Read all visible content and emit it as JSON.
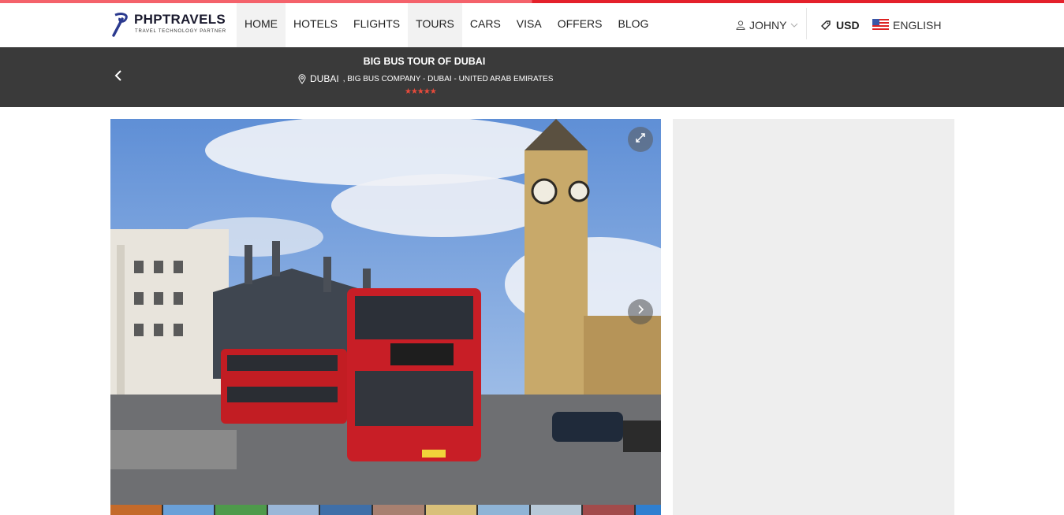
{
  "brand": {
    "name": "PHPTRAVELS",
    "tagline": "TRAVEL TECHNOLOGY PARTNER"
  },
  "nav": {
    "items": [
      {
        "label": "HOME",
        "active": true
      },
      {
        "label": "HOTELS",
        "active": false
      },
      {
        "label": "FLIGHTS",
        "active": false
      },
      {
        "label": "TOURS",
        "active": true
      },
      {
        "label": "CARS",
        "active": false
      },
      {
        "label": "VISA",
        "active": false
      },
      {
        "label": "OFFERS",
        "active": false
      },
      {
        "label": "BLOG",
        "active": false
      }
    ]
  },
  "account": {
    "user": "JOHNY",
    "currency": "USD",
    "language": "ENGLISH"
  },
  "tour": {
    "title": "BIG BUS TOUR OF DUBAI",
    "city": "DUBAI",
    "location_detail": ", BIG BUS COMPANY - DUBAI - UNITED ARAB EMIRATES",
    "stars": "★★★★★",
    "rating": 5
  },
  "gallery": {
    "thumbnail_count": 11
  },
  "icons": {
    "back": "chevron-left-icon",
    "location": "map-pin-icon",
    "user": "user-icon",
    "dropdown": "chevron-down-icon",
    "currency": "money-tag-icon",
    "flag": "us-flag-icon",
    "expand": "expand-icon",
    "next": "chevron-right-icon"
  },
  "colors": {
    "accent": "#e4212b",
    "banner": "#3a3a3a",
    "star": "#e74a3b",
    "sidebar": "#eeeeee"
  }
}
